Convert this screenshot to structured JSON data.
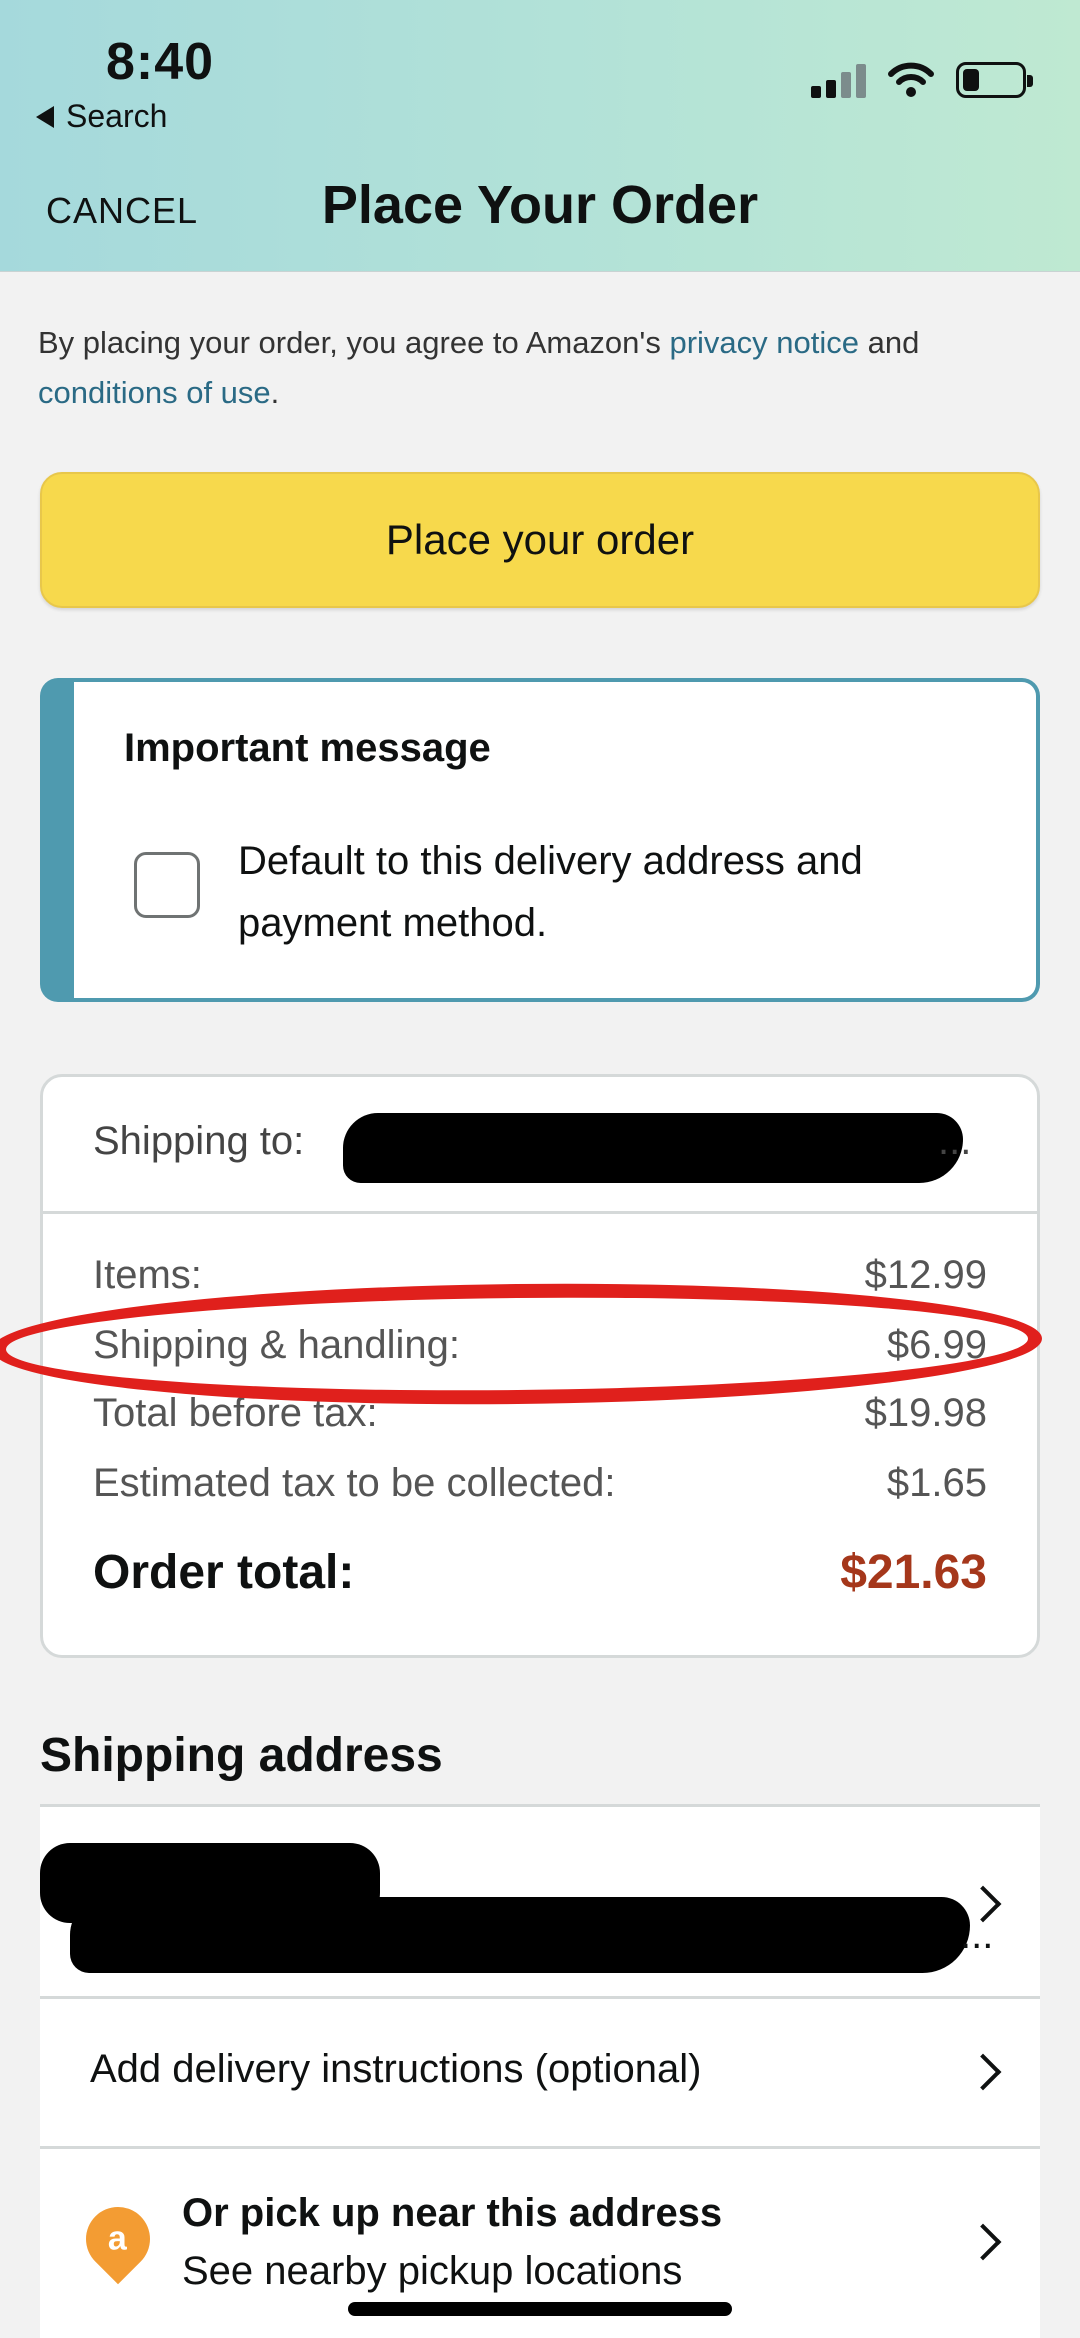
{
  "status_bar": {
    "time": "8:40",
    "back_label": "Search",
    "icons": [
      "signal-icon",
      "wifi-icon",
      "battery-icon"
    ]
  },
  "nav": {
    "cancel": "CANCEL",
    "title": "Place Your Order"
  },
  "agreement": {
    "prefix": "By placing your order, you agree to Amazon's ",
    "privacy_link": "privacy notice",
    "mid": " and ",
    "conditions_link": "conditions of use",
    "suffix": "."
  },
  "place_order_button": "Place your order",
  "important_message": {
    "title": "Important message",
    "checkbox_label": "Default to this delivery address and payment method.",
    "checked": false
  },
  "summary": {
    "shipping_to_label": "Shipping to:",
    "shipping_to_ellipsis": "...",
    "rows": [
      {
        "label": "Items:",
        "value": "$12.99"
      },
      {
        "label": "Shipping & handling:",
        "value": "$6.99"
      },
      {
        "label": "Total before tax:",
        "value": "$19.98"
      },
      {
        "label": "Estimated tax to be collected:",
        "value": "$1.65"
      }
    ],
    "total_label": "Order total:",
    "total_value": "$21.63"
  },
  "shipping_address": {
    "title": "Shipping address",
    "address_ellipsis": "...",
    "delivery_instructions": "Add delivery instructions (optional)",
    "pickup_title": "Or pick up near this address",
    "pickup_subtitle": "See nearby pickup locations",
    "pickup_badge": "a"
  },
  "colors": {
    "header_gradient_start": "#a5d9dc",
    "button_yellow": "#f7d94c",
    "link_teal": "#2a6a85",
    "total_red": "#a5371b",
    "highlight_red": "#e0201c",
    "message_accent": "#4f9aaf"
  }
}
